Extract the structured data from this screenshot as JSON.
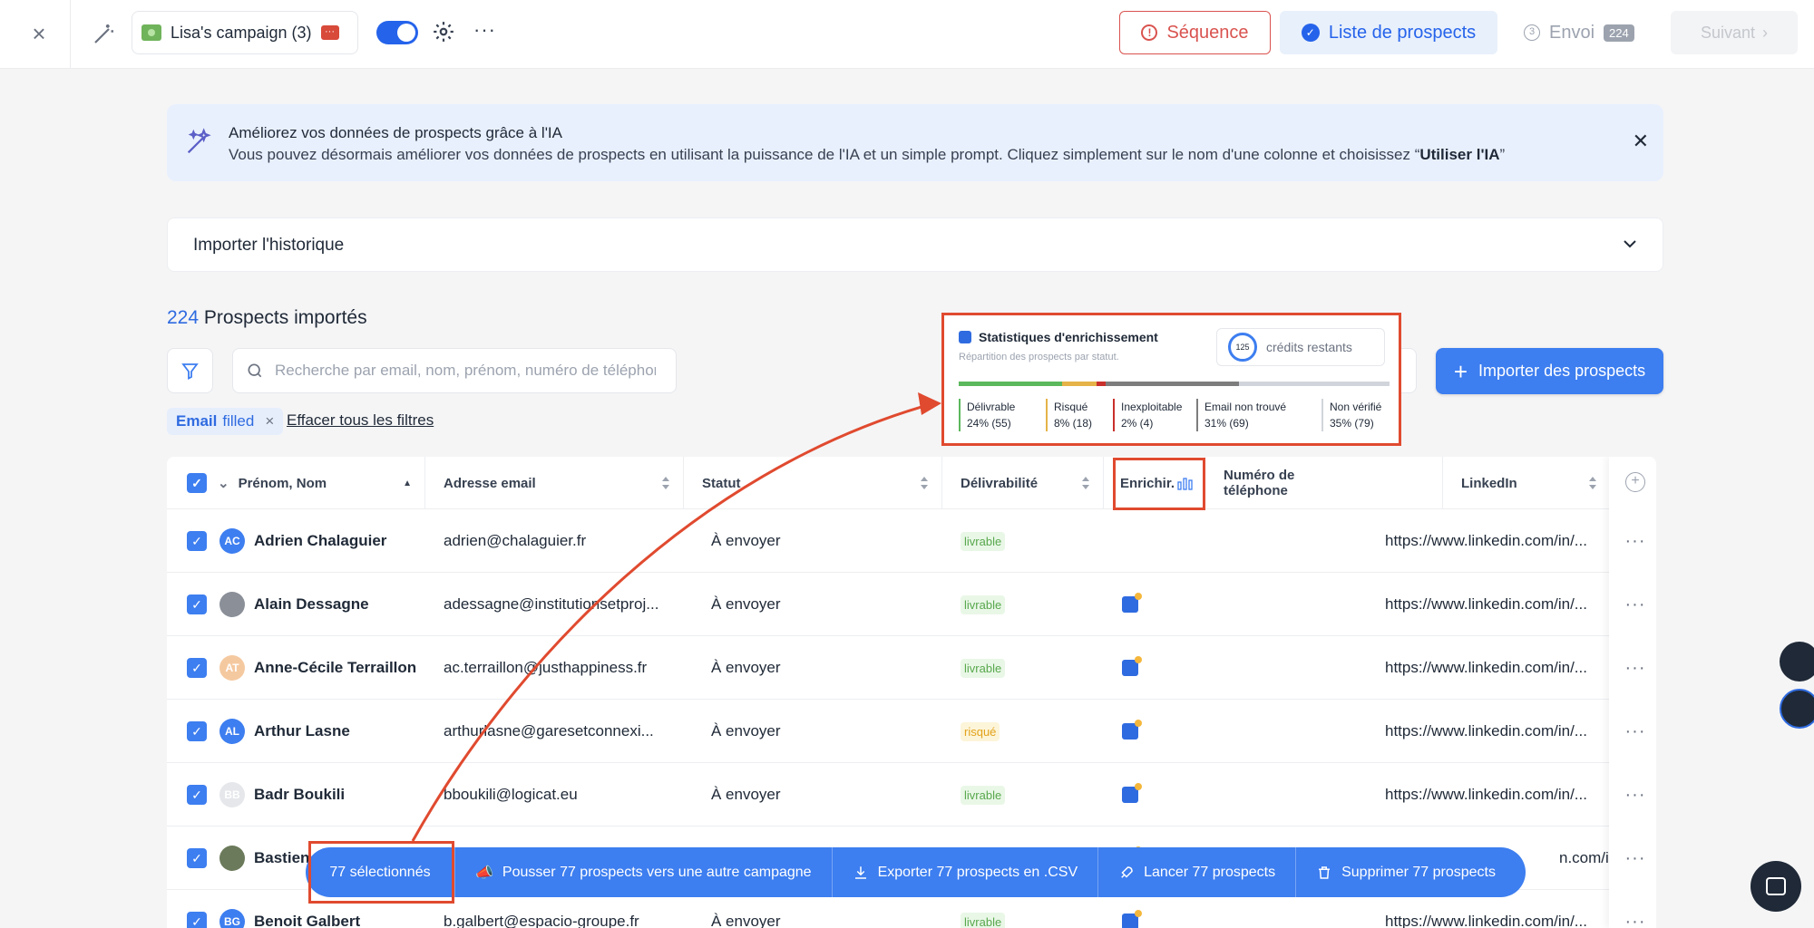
{
  "topbar": {
    "campaign_name": "Lisa's campaign (3)",
    "sequence_label": "Séquence",
    "prospects_label": "Liste de prospects",
    "envoi_label": "Envoi",
    "envoi_count": "224",
    "next_label": "Suivant"
  },
  "banner": {
    "title": "Améliorez vos données de prospects grâce à l'IA",
    "text_before": "Vous pouvez désormais améliorer vos données de prospects en utilisant la puissance de l'IA et un simple prompt. Cliquez simplement sur le nom d'une colonne et choisissez “",
    "text_bold": "Utiliser l'IA",
    "text_after": "”"
  },
  "history": {
    "label": "Importer l'historique"
  },
  "prospects": {
    "count": "224",
    "label": " Prospects importés"
  },
  "search": {
    "placeholder": "Recherche par email, nom, prénom, numéro de téléphone"
  },
  "import_button": "Importer des prospects",
  "filter": {
    "key": "Email",
    "value": "filled",
    "clear_label": "Effacer tous les filtres"
  },
  "stats": {
    "title": "Statistiques d'enrichissement",
    "subtitle": "Répartition des prospects par statut.",
    "credits_value": "125",
    "credits_label": "crédits restants",
    "segments": [
      {
        "label": "Délivrable",
        "value": "24% (55)",
        "color": "#5cb85c",
        "pct": 24
      },
      {
        "label": "Risqué",
        "value": "8% (18)",
        "color": "#e5b347",
        "pct": 8
      },
      {
        "label": "Inexploitable",
        "value": "2% (4)",
        "color": "#c9302c",
        "pct": 2
      },
      {
        "label": "Email non trouvé",
        "value": "31% (69)",
        "color": "#7d7d7d",
        "pct": 31
      },
      {
        "label": "Non vérifié",
        "value": "35% (79)",
        "color": "#d1d5db",
        "pct": 35
      }
    ]
  },
  "table": {
    "headers": {
      "name": "Prénom, Nom",
      "email": "Adresse email",
      "status": "Statut",
      "deliverability": "Délivrabilité",
      "enrich": "Enrichir.",
      "phone": "Numéro de téléphone",
      "linkedin": "LinkedIn"
    },
    "rows": [
      {
        "initials": "AC",
        "avatar_color": "#3d7ef0",
        "name": "Adrien Chalaguier",
        "email": "adrien@chalaguier.fr",
        "status": "À envoyer",
        "deliv": "livrable",
        "enriched": false,
        "linkedin": "https://www.linkedin.com/in/..."
      },
      {
        "initials": "",
        "avatar_color": "#8a8f98",
        "name": "Alain Dessagne",
        "email": "adessagne@institutionsetproj...",
        "status": "À envoyer",
        "deliv": "livrable",
        "enriched": true,
        "linkedin": "https://www.linkedin.com/in/..."
      },
      {
        "initials": "AT",
        "avatar_color": "#f5c9a0",
        "name": "Anne-Cécile Terraillon",
        "email": "ac.terraillon@justhappiness.fr",
        "status": "À envoyer",
        "deliv": "livrable",
        "enriched": true,
        "linkedin": "https://www.linkedin.com/in/..."
      },
      {
        "initials": "AL",
        "avatar_color": "#3d7ef0",
        "name": "Arthur Lasne",
        "email": "arthurlasne@garesetconnexi...",
        "status": "À envoyer",
        "deliv": "risqué",
        "enriched": true,
        "linkedin": "https://www.linkedin.com/in/..."
      },
      {
        "initials": "BB",
        "avatar_color": "#e5e7eb",
        "name": "Badr Boukili",
        "email": "bboukili@logicat.eu",
        "status": "À envoyer",
        "deliv": "livrable",
        "enriched": true,
        "linkedin": "https://www.linkedin.com/in/..."
      },
      {
        "initials": "",
        "avatar_color": "#6b7a5a",
        "name": "Bastien",
        "email": "",
        "status": "",
        "deliv": "",
        "enriched": true,
        "linkedin": "n.com/in/..."
      },
      {
        "initials": "BG",
        "avatar_color": "#3d7ef0",
        "name": "Benoit Galbert",
        "email": "b.galbert@espacio-groupe.fr",
        "status": "À envoyer",
        "deliv": "livrable",
        "enriched": true,
        "linkedin": "https://www.linkedin.com/in/..."
      }
    ]
  },
  "bulk": {
    "selected": "77 sélectionnés",
    "push": "Pousser 77 prospects vers une autre campagne",
    "export": "Exporter 77 prospects en .CSV",
    "launch": "Lancer 77 prospects",
    "delete": "Supprimer 77 prospects"
  },
  "icons": {
    "close": "close-icon",
    "wand": "magic-wand-icon",
    "gear": "gear-icon",
    "sparkle": "ai-sparkle-icon",
    "chevron": "chevron-down-icon",
    "filter": "filter-icon",
    "search": "search-icon",
    "plus": "plus-icon"
  }
}
